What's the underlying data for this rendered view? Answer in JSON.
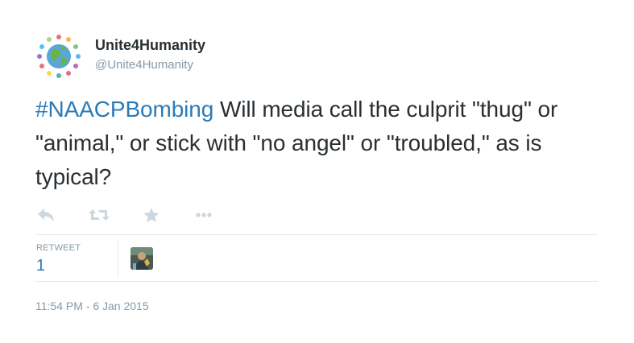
{
  "author": {
    "display_name": "Unite4Humanity",
    "handle": "@Unite4Humanity",
    "avatar_icon": "globe-with-people-avatar-icon"
  },
  "tweet": {
    "hashtag": "#NAACPBombing",
    "text": " Will media call the culprit \"thug\" or \"animal,\" or stick with \"no angel\" or \"troubled,\" as is typical?"
  },
  "actions": {
    "reply_icon": "reply-icon",
    "retweet_icon": "retweet-icon",
    "favorite_icon": "star-icon",
    "more_icon": "more-icon"
  },
  "stats": {
    "retweet_label": "RETWEET",
    "retweet_count": "1",
    "retweeter_avatar_icon": "retweeter-avatar-icon"
  },
  "timestamp": "11:54 PM - 6 Jan 2015",
  "colors": {
    "link": "#2b7bb9",
    "muted": "#8899a6",
    "text": "#292f33",
    "action_icon": "#ccd6dd",
    "divider": "#e1e8ed"
  }
}
